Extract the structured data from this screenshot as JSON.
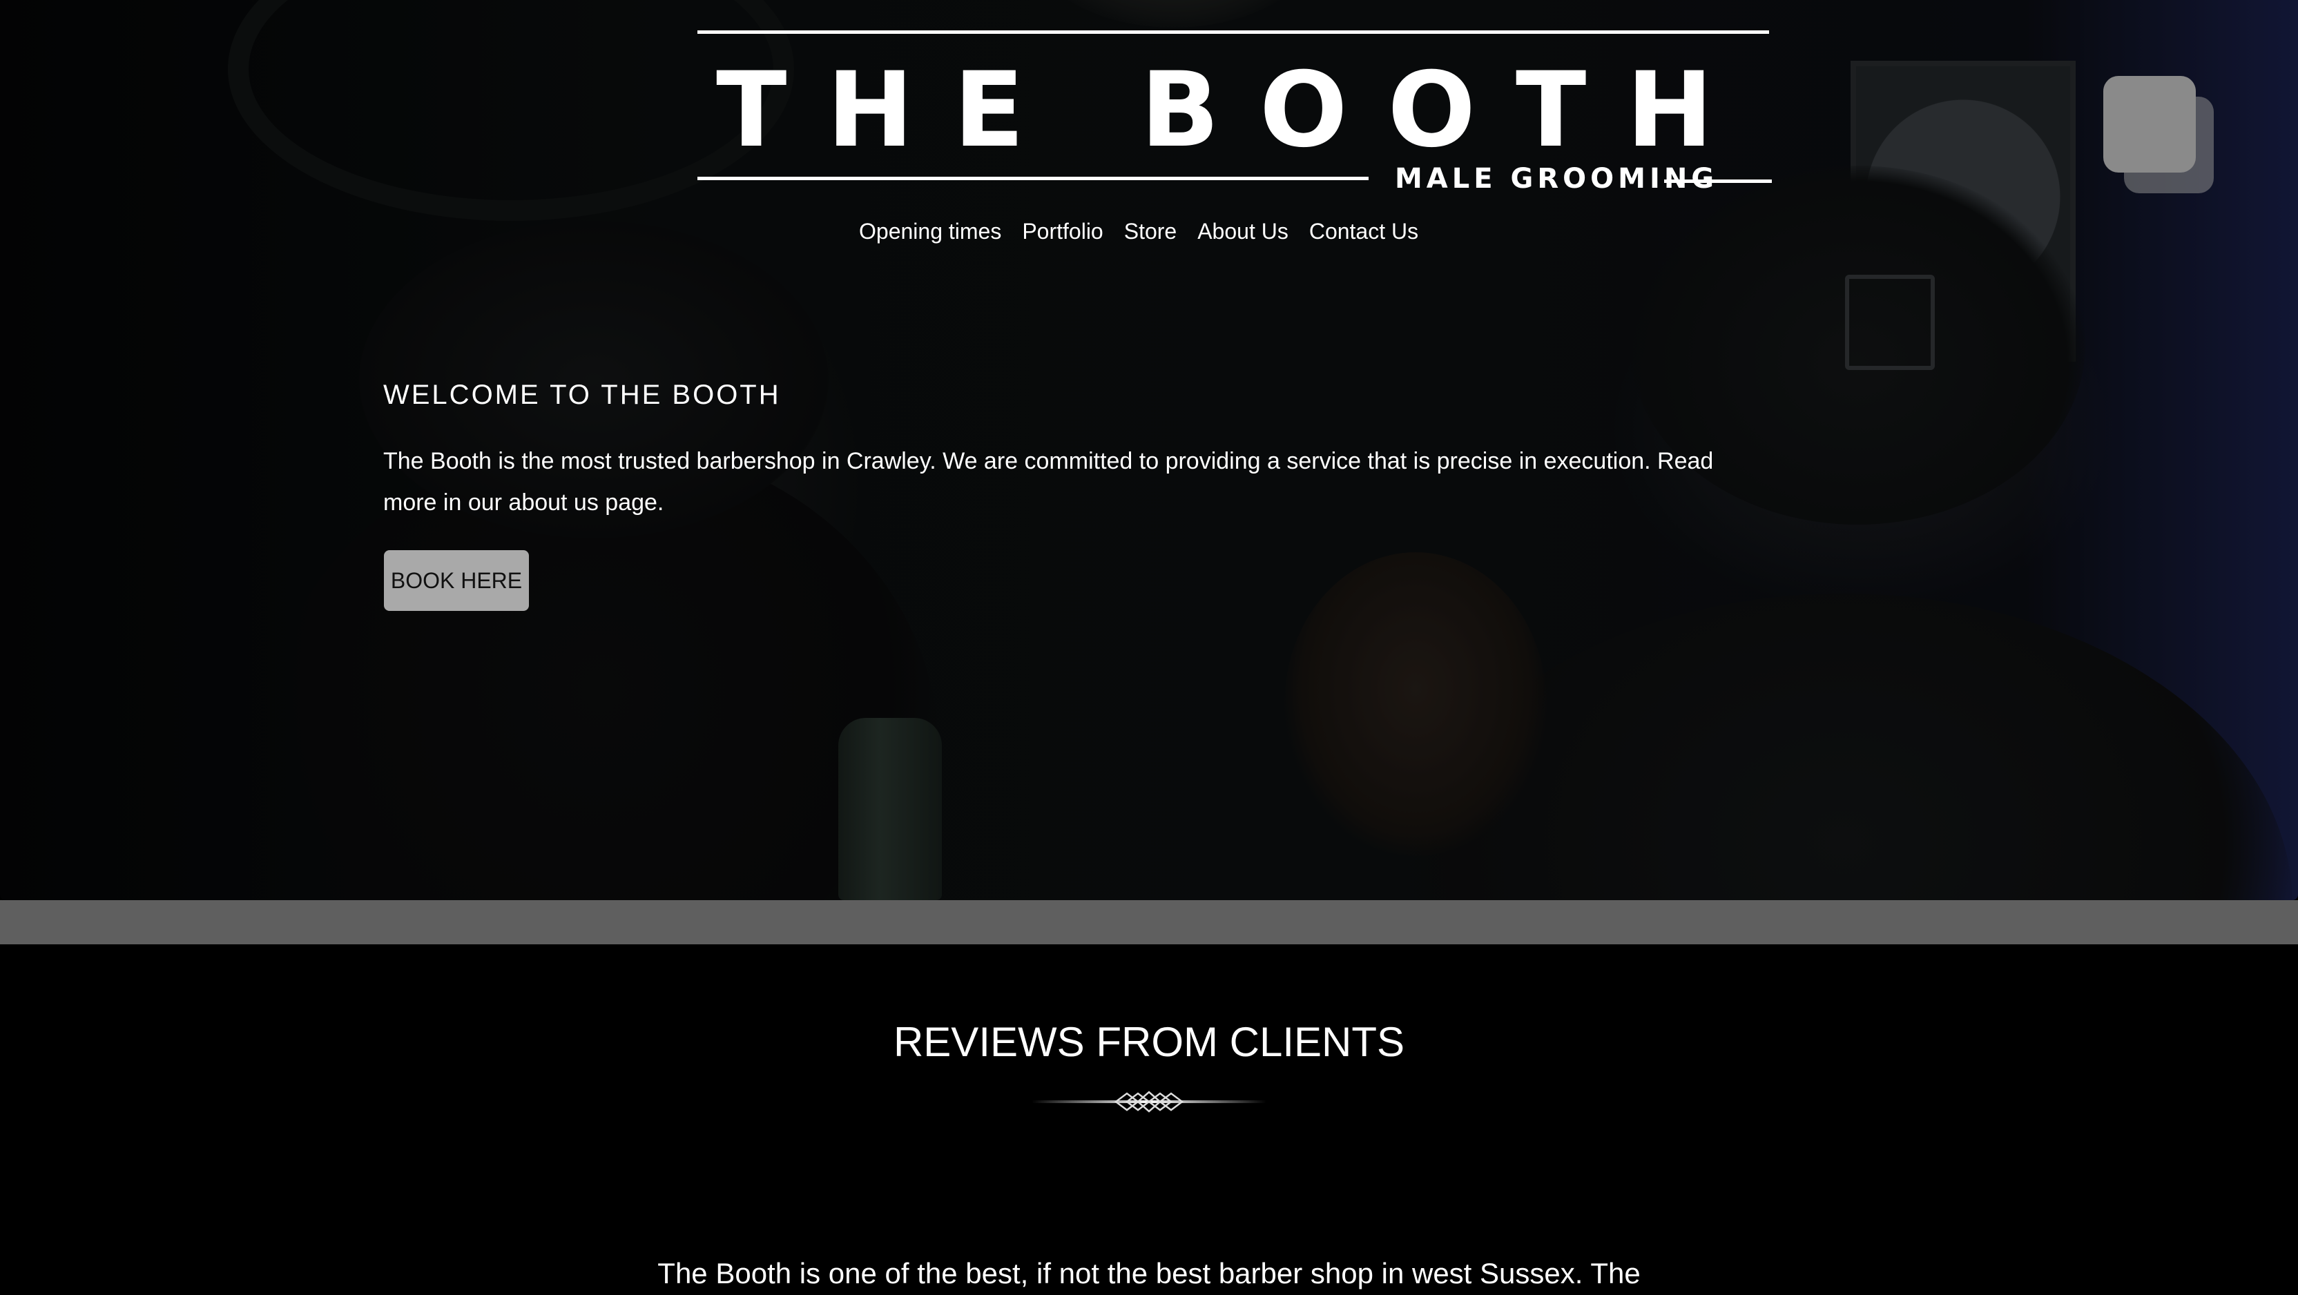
{
  "brand": {
    "title": "THE BOOTH",
    "subtitle": "MALE GROOMING"
  },
  "nav": {
    "items": [
      {
        "label": "Opening times"
      },
      {
        "label": "Portfolio"
      },
      {
        "label": "Store"
      },
      {
        "label": "About Us"
      },
      {
        "label": "Contact Us"
      }
    ]
  },
  "hero": {
    "heading": "WELCOME TO THE BOOTH",
    "body": "The Booth is the most trusted barbershop in Crawley. We are committed to providing a service that is precise in execution. Read more in our about us page.",
    "button_label": "BOOK HERE"
  },
  "reviews": {
    "title": "REVIEWS FROM CLIENTS",
    "first_review": "The Booth is one of the best, if not the best barber shop in west Sussex. The"
  },
  "colors": {
    "page_bg": "#000000",
    "band": "#5f5f5f",
    "button_bg": "#a9a9a9",
    "text": "#ffffff"
  },
  "icons": {
    "corner": "chat-bubbles-icon",
    "divider": "ornamental-divider-icon"
  }
}
